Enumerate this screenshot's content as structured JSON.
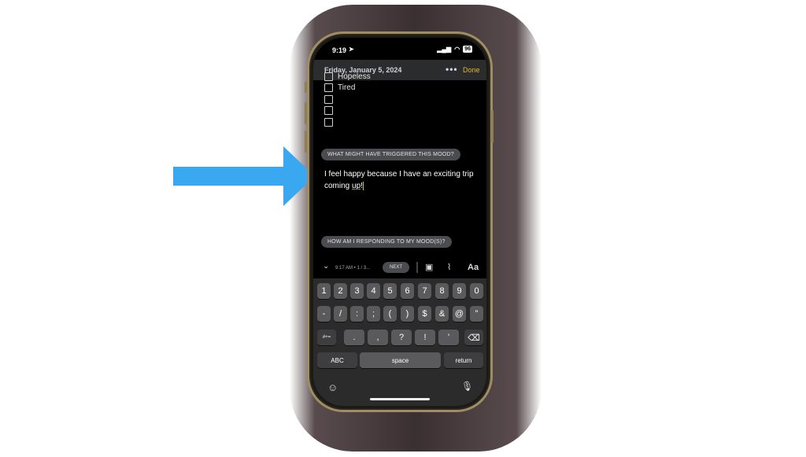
{
  "status_bar": {
    "time": "9:19",
    "battery": "96"
  },
  "header": {
    "date": "Friday, January 5, 2024",
    "more": "•••",
    "done": "Done"
  },
  "checklist": {
    "cut_item": "Hopeless",
    "items": [
      "Tired",
      "",
      "",
      ""
    ]
  },
  "prompts": {
    "trigger": "WHAT MIGHT HAVE TRIGGERED THIS MOOD?",
    "response": "HOW AM I RESPONDING TO MY MOOD(S)?"
  },
  "entry": {
    "line1": "I feel happy because I have an exciting trip",
    "line2_a": "coming ",
    "line2_b": "up",
    "line2_c": "!"
  },
  "toolbar": {
    "stamp": "9:17 AM • 1 / 3...",
    "next": "NEXT",
    "format": "Aa"
  },
  "keyboard": {
    "row1": [
      "1",
      "2",
      "3",
      "4",
      "5",
      "6",
      "7",
      "8",
      "9",
      "0"
    ],
    "row2": [
      "-",
      "/",
      ":",
      ";",
      "(",
      ")",
      "$",
      "&",
      "@",
      "”"
    ],
    "row3_left": "#+=",
    "row3": [
      ".",
      ",",
      "?",
      "!",
      "’"
    ],
    "abc": "ABC",
    "space": "space",
    "return": "return"
  },
  "colors": {
    "accent": "#e9b52a",
    "arrow": "#3aa8f0",
    "frame": "#a08e63"
  }
}
